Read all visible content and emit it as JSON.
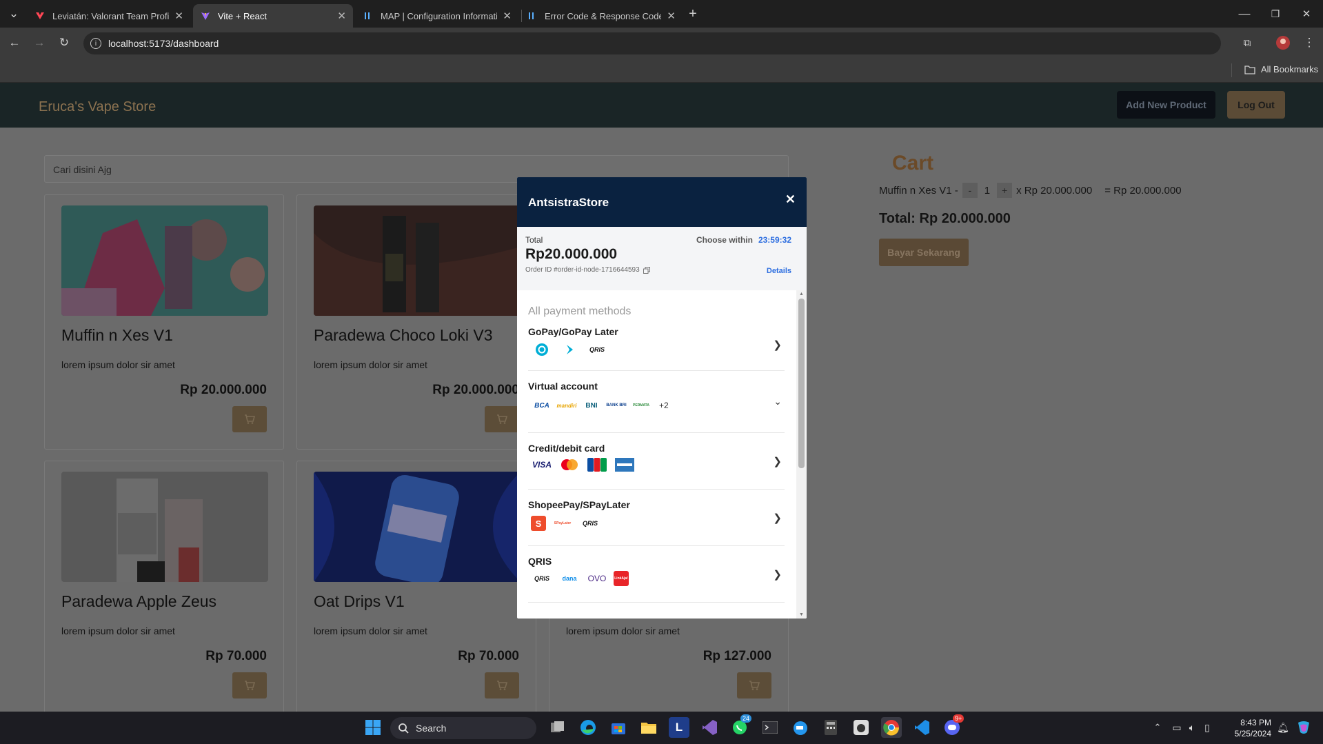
{
  "browser": {
    "tabs": [
      {
        "title": "Leviatán: Valorant Team Profile",
        "active": false
      },
      {
        "title": "Vite + React",
        "active": true
      },
      {
        "title": "MAP | Configuration Informatio",
        "active": false
      },
      {
        "title": "Error Code & Response Code",
        "active": false
      }
    ],
    "url": "localhost:5173/dashboard",
    "bookmarks_label": "All Bookmarks"
  },
  "store": {
    "brand": "Eruca's Vape Store",
    "add_product_label": "Add New Product",
    "logout_label": "Log Out",
    "search_placeholder": "Cari disini Ajg",
    "products": [
      {
        "name": "Muffin n Xes V1",
        "desc": "lorem ipsum dolor sir amet",
        "price": "Rp 20.000.000"
      },
      {
        "name": "Paradewa Choco Loki V3",
        "desc": "lorem ipsum dolor sir amet",
        "price": "Rp 20.000.000"
      },
      {
        "name": "Paradewa Apple Zeus",
        "desc": "lorem ipsum dolor sir amet",
        "price": "Rp 70.000"
      },
      {
        "name": "Oat Drips V1",
        "desc": "lorem ipsum dolor sir amet",
        "price": "Rp 70.000"
      },
      {
        "name": "",
        "desc": "lorem ipsum dolor sir amet",
        "price": "Rp 127.000"
      }
    ]
  },
  "cart": {
    "title": "Cart",
    "item_name": "Muffin n Xes V1 -",
    "minus": "-",
    "qty": "1",
    "plus": "+",
    "unit": "x Rp 20.000.000",
    "subtotal": "= Rp 20.000.000",
    "total": "Total: Rp 20.000.000",
    "pay_label": "Bayar Sekarang"
  },
  "payment": {
    "merchant": "AntsistraStore",
    "total_label": "Total",
    "amount": "Rp20.000.000",
    "choose_within": "Choose within",
    "countdown": "23:59:32",
    "order_id": "Order ID #order-id-node-1716644593",
    "details_label": "Details",
    "section_title": "All payment methods",
    "methods": [
      {
        "title": "GoPay/GoPay Later",
        "logos": [
          "gopay",
          "gopaylater",
          "QRIS"
        ]
      },
      {
        "title": "Virtual account",
        "logos": [
          "BCA",
          "mandiri",
          "BNI",
          "BANK BRI",
          "PERMATA"
        ],
        "more": "+2"
      },
      {
        "title": "Credit/debit card",
        "logos": [
          "VISA",
          "mastercard",
          "JCB",
          "AMEX"
        ]
      },
      {
        "title": "ShopeePay/SPayLater",
        "logos": [
          "S",
          "SPayLater",
          "QRIS"
        ]
      },
      {
        "title": "QRIS",
        "logos": [
          "QRIS",
          "dana",
          "OVO",
          "LinkAja!"
        ]
      }
    ]
  },
  "taskbar": {
    "search_label": "Search",
    "time": "8:43 PM",
    "date": "5/25/2024",
    "whatsapp_badge": "24",
    "discord_badge": "9+"
  },
  "colors": {
    "navbar": "#1a2526",
    "modal_header": "#0a2240",
    "accent_gold": "#8c7250",
    "countdown_blue": "#2d6ee0"
  }
}
